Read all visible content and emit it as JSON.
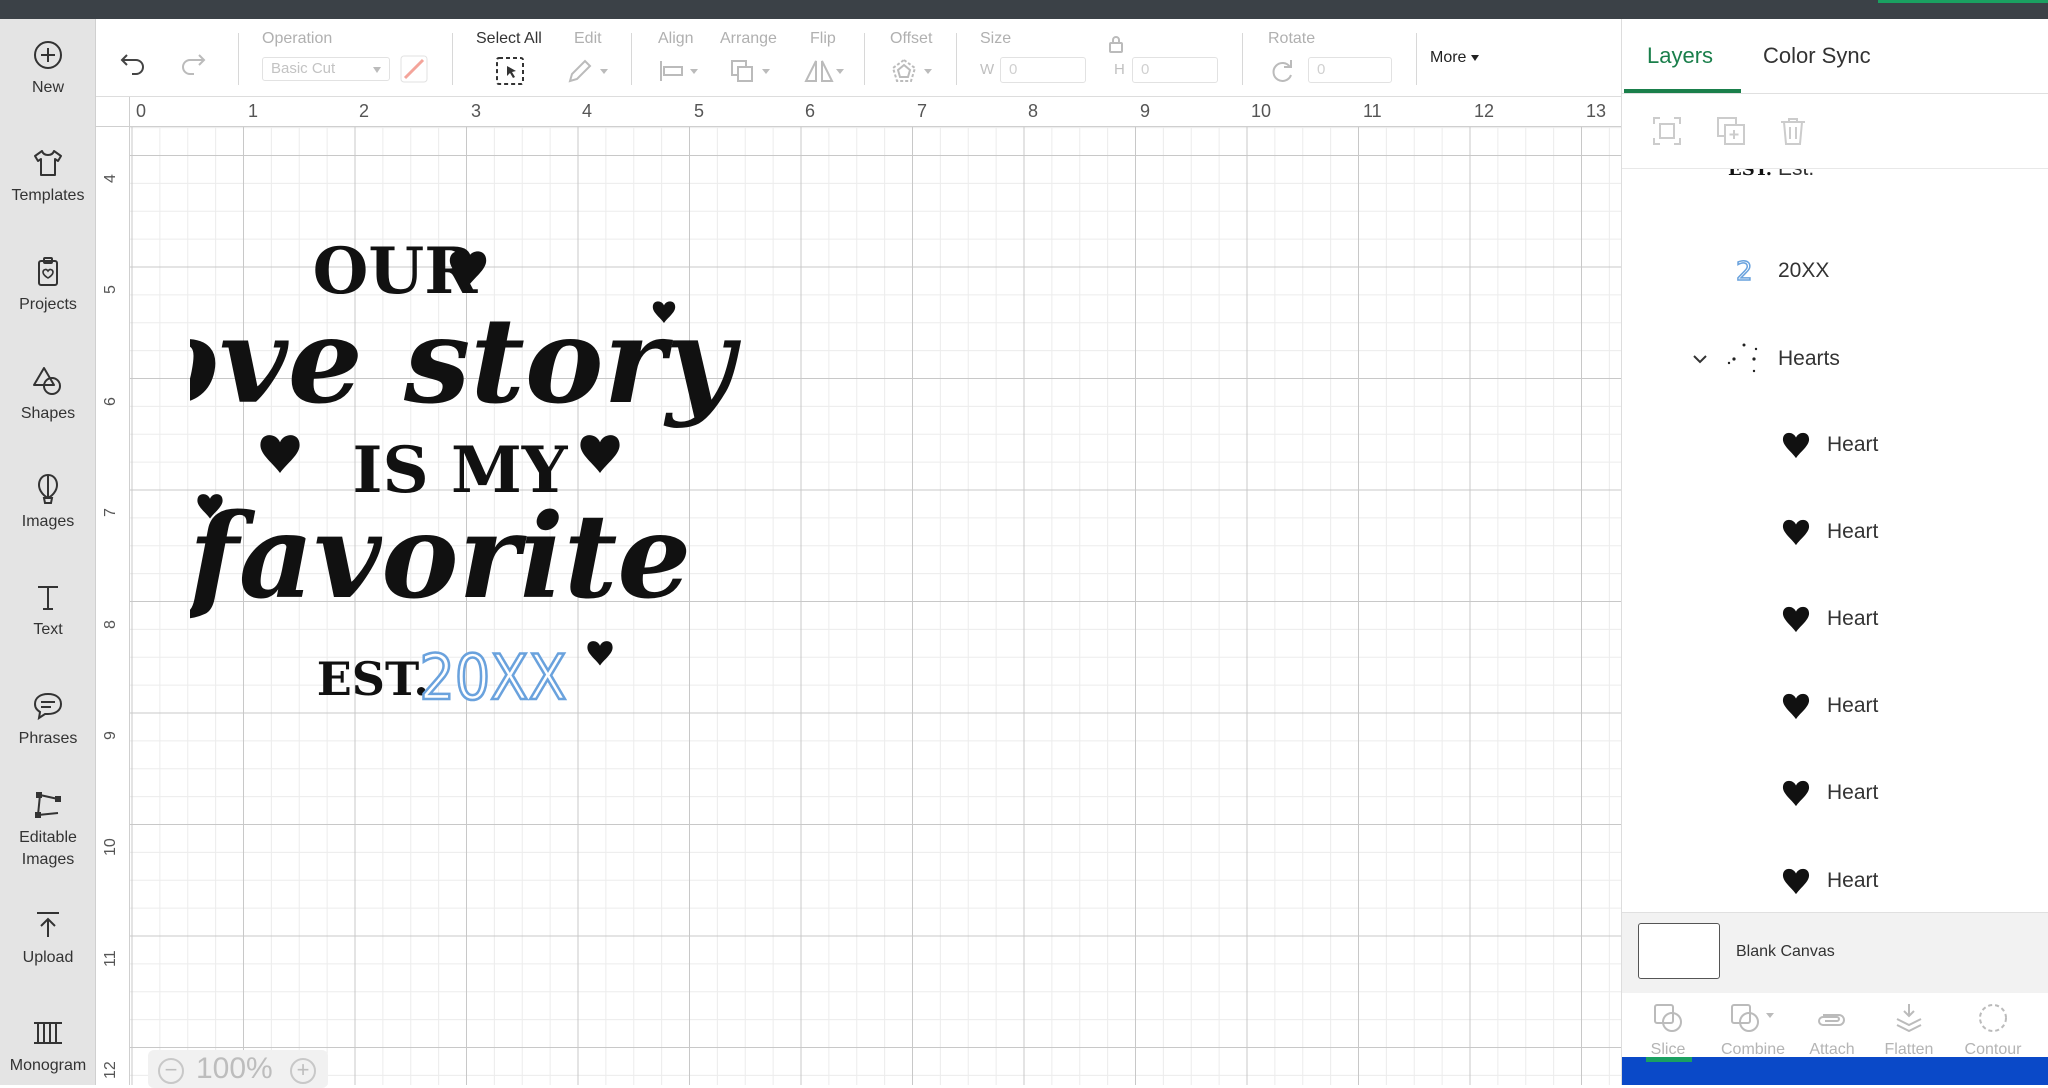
{
  "sidebar": {
    "items": [
      {
        "label": "New",
        "icon": "plus-circle-icon"
      },
      {
        "label": "Templates",
        "icon": "tshirt-icon"
      },
      {
        "label": "Projects",
        "icon": "clipboard-heart-icon"
      },
      {
        "label": "Shapes",
        "icon": "shapes-icon"
      },
      {
        "label": "Images",
        "icon": "balloon-icon"
      },
      {
        "label": "Text",
        "icon": "text-icon"
      },
      {
        "label": "Phrases",
        "icon": "speech-bubble-icon"
      },
      {
        "label": "Editable Images",
        "icon": "edit-nodes-icon"
      },
      {
        "label": "Upload",
        "icon": "upload-icon"
      },
      {
        "label": "Monogram",
        "icon": "monogram-icon"
      }
    ]
  },
  "toolbar": {
    "operation_label": "Operation",
    "operation_value": "Basic Cut",
    "select_all_label": "Select All",
    "edit_label": "Edit",
    "align_label": "Align",
    "arrange_label": "Arrange",
    "flip_label": "Flip",
    "offset_label": "Offset",
    "size_label": "Size",
    "width_prefix": "W",
    "width_value": "0",
    "height_prefix": "H",
    "height_value": "0",
    "rotate_label": "Rotate",
    "rotate_value": "0",
    "more_label": "More"
  },
  "ruler": {
    "h_numbers": [
      "0",
      "1",
      "2",
      "3",
      "4",
      "5",
      "6",
      "7",
      "8",
      "9",
      "10",
      "11",
      "12",
      "13"
    ],
    "v_numbers": [
      "4",
      "5",
      "6",
      "7",
      "8",
      "9",
      "10",
      "11",
      "12"
    ]
  },
  "artwork": {
    "line1": "OUR",
    "line2": "love story",
    "line3": "IS MY",
    "line4": "favorite",
    "line5_est": "EST.",
    "line5_year": "20XX"
  },
  "zoom": {
    "value": "100%",
    "minus": "−",
    "plus": "+"
  },
  "panel": {
    "tabs": [
      {
        "label": "Layers"
      },
      {
        "label": "Color Sync"
      }
    ],
    "layers": [
      {
        "name": "Est."
      },
      {
        "name": "20XX"
      },
      {
        "name": "Hearts"
      },
      {
        "name": "Heart"
      },
      {
        "name": "Heart"
      },
      {
        "name": "Heart"
      },
      {
        "name": "Heart"
      },
      {
        "name": "Heart"
      },
      {
        "name": "Heart"
      }
    ],
    "canvas_label": "Blank Canvas",
    "bottom_tools": [
      "Slice",
      "Combine",
      "Attach",
      "Flatten",
      "Contour"
    ]
  },
  "colors": {
    "accent": "#1a7f4b",
    "year_blue": "#6aa2dd",
    "bottom_bar": "#0a49c8"
  }
}
